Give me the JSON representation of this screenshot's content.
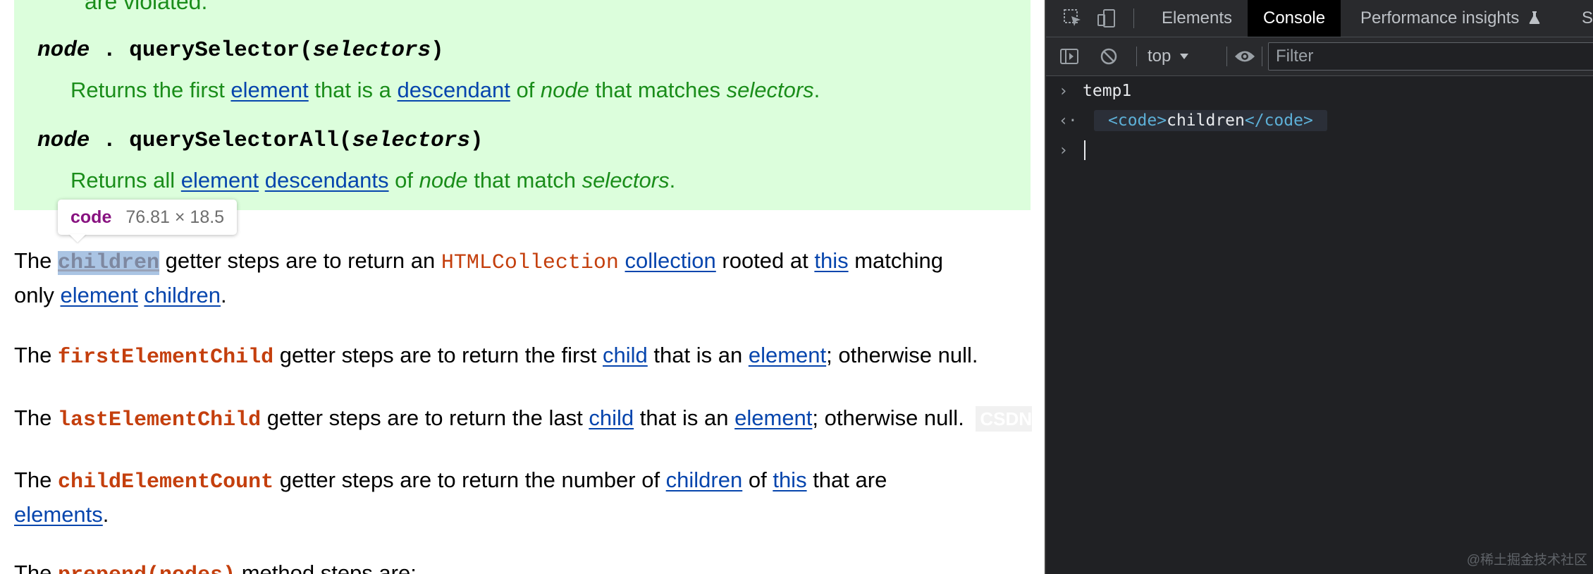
{
  "document": {
    "note_top_tail": "are violated.",
    "qs": {
      "obj": "node",
      "dot": ".",
      "method": "querySelector(",
      "arg": "selectors",
      "close": ")",
      "desc": {
        "t1": "Returns the first ",
        "l1": "element",
        "t2": " that is a ",
        "l2": "descendant",
        "t3": " of ",
        "i1": "node",
        "t4": " that matches ",
        "i2": "selectors",
        "t5": "."
      }
    },
    "qsa": {
      "obj": "node",
      "dot": ".",
      "method": "querySelectorAll(",
      "arg": "selectors",
      "close": ")",
      "desc": {
        "t1": "Returns all ",
        "l1": "element",
        "t2": " ",
        "l2": "descendants",
        "t3": " of ",
        "i1": "node",
        "t4": " that match ",
        "i2": "selectors",
        "t5": "."
      }
    },
    "tooltip": {
      "tag": "code",
      "dims": "76.81 × 18.5"
    },
    "p_children": {
      "t1": "The ",
      "code": "children",
      "t2": " getter steps are to return an ",
      "ref": "HTMLCollection",
      "t3": " ",
      "l1": "collection",
      "t4": " rooted at ",
      "l2": "this",
      "t5": " matching",
      "t6": "only ",
      "l3": "element",
      "t7": " ",
      "l4": "children",
      "t8": "."
    },
    "p_first": {
      "t1": "The ",
      "code": "firstElementChild",
      "t2": " getter steps are to return the first ",
      "l1": "child",
      "t3": " that is an ",
      "l2": "element",
      "t4": "; otherwise null."
    },
    "p_last": {
      "t1": "The ",
      "code": "lastElementChild",
      "t2": " getter steps are to return the last ",
      "l1": "child",
      "t3": " that is an ",
      "l2": "element",
      "t4": "; otherwise null."
    },
    "p_count": {
      "t1": "The ",
      "code": "childElementCount",
      "t2": " getter steps are to return the number of ",
      "l1": "children",
      "t3": " of ",
      "l2": "this",
      "t4": " that are",
      "l3": "elements",
      "t5": "."
    },
    "p_prepend": {
      "t1": "The ",
      "code": "prepend(nodes)",
      "t2": " method steps are:"
    },
    "overlay_text": "CSDN"
  },
  "devtools": {
    "tabs": [
      "Elements",
      "Console",
      "Performance insights",
      "S"
    ],
    "active_tab": "Console",
    "context": "top",
    "filter_placeholder": "Filter",
    "console": {
      "input": "temp1",
      "result_open": "<code>",
      "result_text": "children",
      "result_close": "</code>"
    },
    "watermark": "@稀土掘金技术社区"
  },
  "colors": {
    "note_bg": "#dcfedc",
    "note_text": "#1a8d1a",
    "link": "#0645ad",
    "code_def": "#c43f0d",
    "tooltip_tag": "#881280",
    "devtools_bg": "#202124",
    "html_tag": "#5db0d7"
  }
}
